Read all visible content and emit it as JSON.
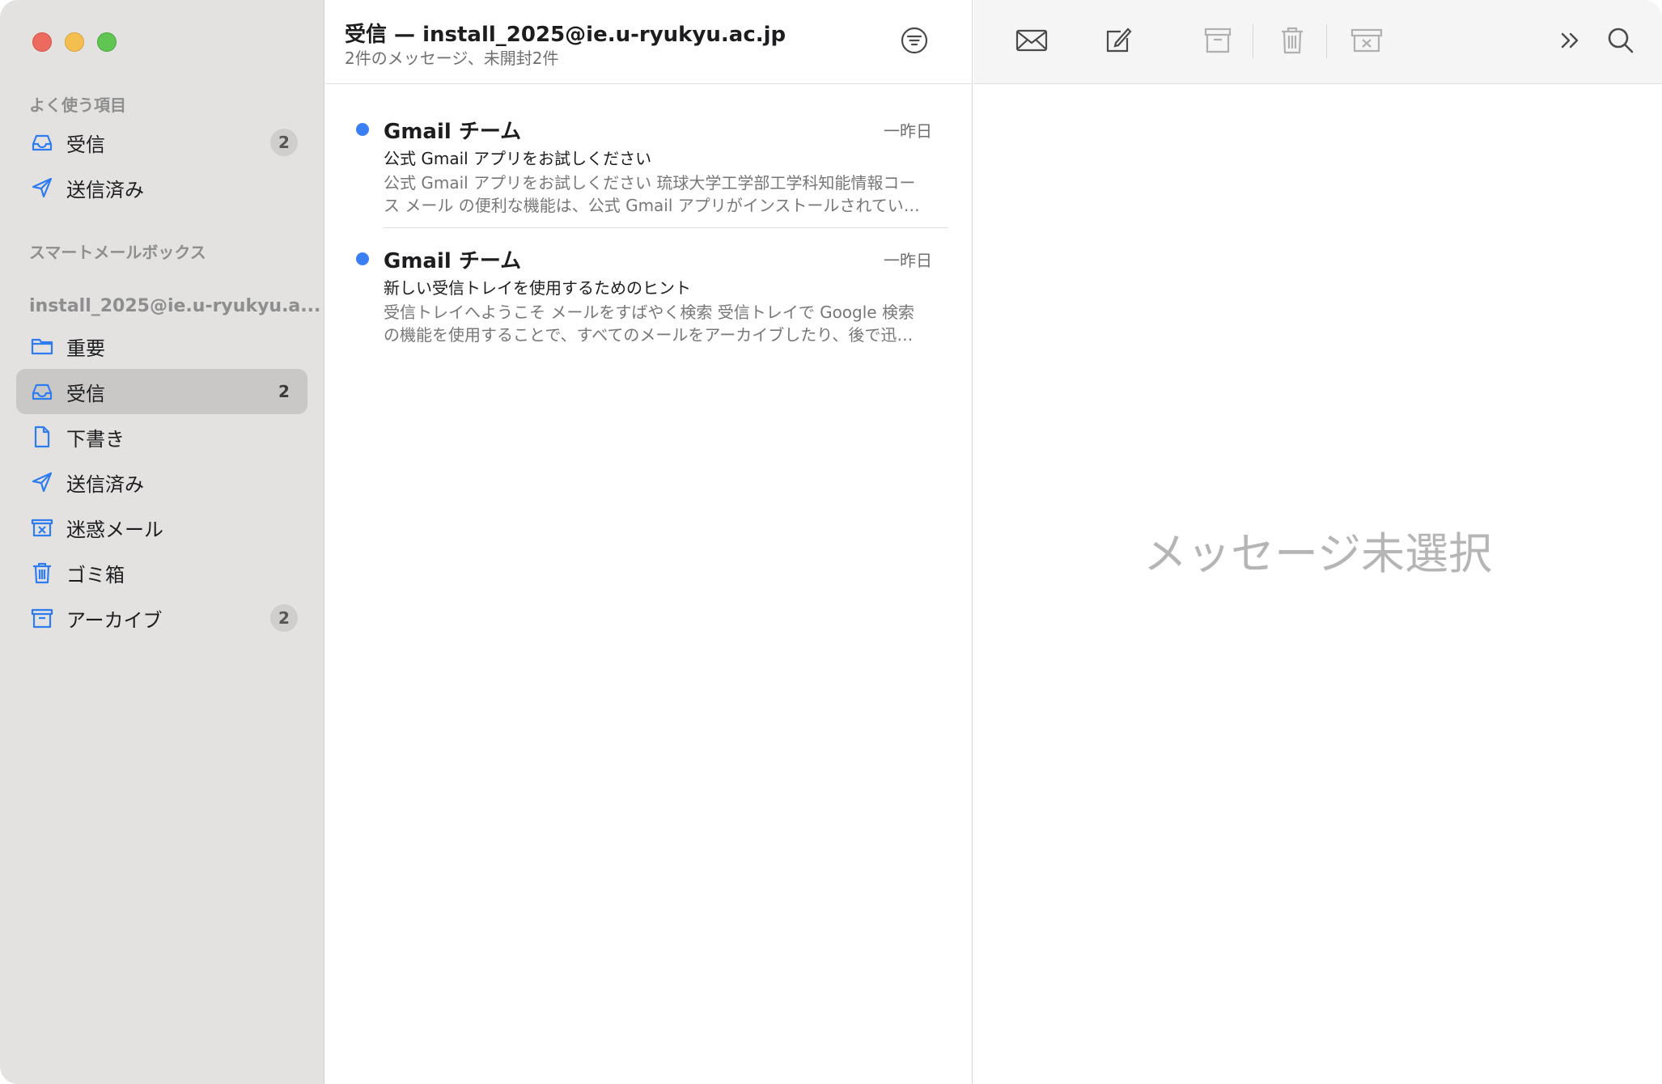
{
  "sidebar": {
    "favorites_label": "よく使う項目",
    "favorites": [
      {
        "label": "受信",
        "icon": "inbox-icon",
        "badge": "2"
      },
      {
        "label": "送信済み",
        "icon": "paperplane-icon",
        "badge": ""
      }
    ],
    "smart_label": "スマートメールボックス",
    "account_label": "install_2025@ie.u-ryukyu.a...",
    "mailboxes": [
      {
        "label": "重要",
        "icon": "folder-icon",
        "badge": ""
      },
      {
        "label": "受信",
        "icon": "inbox-icon",
        "badge": "2",
        "selected": true
      },
      {
        "label": "下書き",
        "icon": "document-icon",
        "badge": ""
      },
      {
        "label": "送信済み",
        "icon": "paperplane-icon",
        "badge": ""
      },
      {
        "label": "迷惑メール",
        "icon": "junk-icon",
        "badge": ""
      },
      {
        "label": "ゴミ箱",
        "icon": "trash-icon",
        "badge": ""
      },
      {
        "label": "アーカイブ",
        "icon": "archive-icon",
        "badge": "2"
      }
    ]
  },
  "list": {
    "title": "受信 — install_2025@ie.u-ryukyu.ac.jp",
    "subtitle": "2件のメッセージ、未開封2件",
    "messages": [
      {
        "sender": "Gmail チーム",
        "date": "一昨日",
        "subject": "公式 Gmail アプリをお試しください",
        "preview": "公式 Gmail アプリをお試しください 琉球大学工学部工学科知能情報コース メール の便利な機能は、公式 Gmail アプリがインストールされていると一層便利です",
        "unread": true
      },
      {
        "sender": "Gmail チーム",
        "date": "一昨日",
        "subject": "新しい受信トレイを使用するためのヒント",
        "preview": "受信トレイへようこそ メールをすばやく検索 受信トレイで Google 検索の機能を使用することで、すべてのメールをアーカイブしたり、後で迅速に見つけたりできます",
        "unread": true
      }
    ]
  },
  "reader": {
    "empty_text": "メッセージ未選択",
    "toolbar": [
      "envelope-icon",
      "compose-icon",
      "archive-icon",
      "trash-icon",
      "junk-icon",
      "chevrons-right-icon",
      "search-icon"
    ]
  },
  "colors": {
    "accent": "#3a7ff6",
    "sidebar_bg": "#e3e2e0",
    "selected_bg": "#c9c8c6"
  }
}
